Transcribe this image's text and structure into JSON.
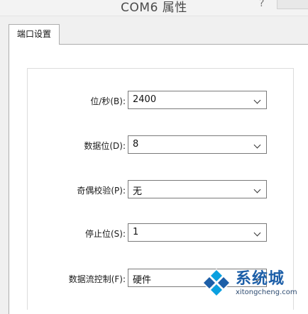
{
  "window": {
    "title": "COM6 属性",
    "help_label": "?"
  },
  "tabs": [
    {
      "label": "端口设置",
      "selected": true
    }
  ],
  "fields": [
    {
      "label": "位/秒(B):",
      "value": "2400"
    },
    {
      "label": "数据位(D):",
      "value": "8"
    },
    {
      "label": "奇偶校验(P):",
      "value": "无"
    },
    {
      "label": "停止位(S):",
      "value": "1"
    },
    {
      "label": "数据流控制(F):",
      "value": "硬件"
    }
  ],
  "watermark": {
    "brand": "系统城",
    "url": "xitongcheng.com"
  },
  "colors": {
    "watermark_blue": "#1d5fa8",
    "watermark_accent": "#0aa0e0"
  }
}
